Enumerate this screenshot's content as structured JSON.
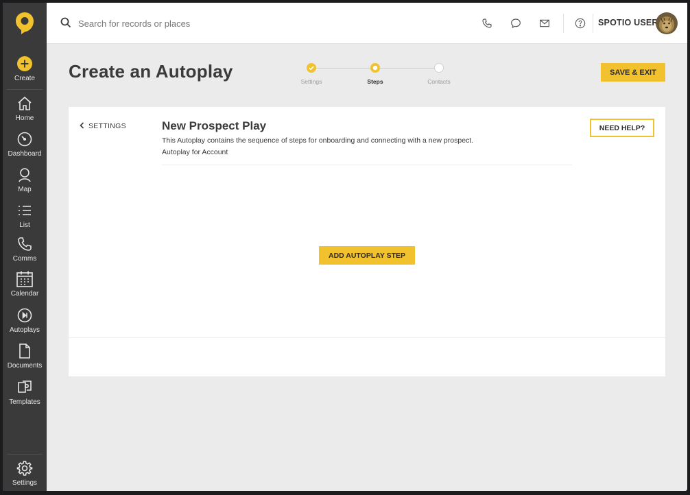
{
  "sidebar": {
    "items": [
      {
        "label": "Create",
        "icon": "plus-circle-icon"
      },
      {
        "label": "Home",
        "icon": "home-icon"
      },
      {
        "label": "Dashboard",
        "icon": "speedometer-icon"
      },
      {
        "label": "Map",
        "icon": "map-pin-icon"
      },
      {
        "label": "List",
        "icon": "list-icon"
      },
      {
        "label": "Comms",
        "icon": "phone-icon"
      },
      {
        "label": "Calendar",
        "icon": "calendar-icon"
      },
      {
        "label": "Autoplays",
        "icon": "play-skip-icon"
      },
      {
        "label": "Documents",
        "icon": "document-icon"
      },
      {
        "label": "Templates",
        "icon": "templates-icon"
      },
      {
        "label": "Settings",
        "icon": "gear-icon"
      }
    ]
  },
  "header": {
    "search_placeholder": "Search for records or places",
    "user_name": "SPOTIO USER"
  },
  "page": {
    "title": "Create an Autoplay",
    "save_label": "SAVE & EXIT"
  },
  "stepper": {
    "steps": [
      {
        "label": "Settings",
        "state": "complete"
      },
      {
        "label": "Steps",
        "state": "active"
      },
      {
        "label": "Contacts",
        "state": "pending"
      }
    ]
  },
  "card": {
    "back_label": "SETTINGS",
    "title": "New Prospect Play",
    "description": "This Autoplay contains the sequence of steps for onboarding and connecting with a new prospect.",
    "type": "Autoplay for Account",
    "help_label": "NEED HELP?",
    "add_step_label": "ADD AUTOPLAY STEP"
  },
  "colors": {
    "accent": "#f2c12e",
    "sidebar_bg": "#3a3a3a",
    "page_bg": "#ebebeb"
  }
}
